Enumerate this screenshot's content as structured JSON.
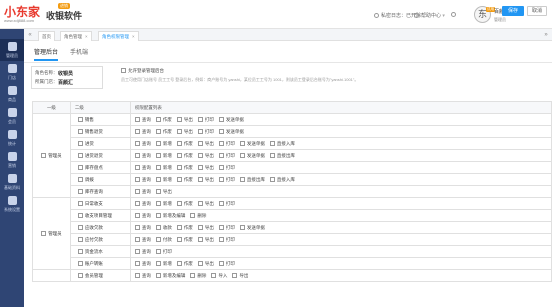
{
  "header": {
    "logo_text": "小东家",
    "logo_badge": "进销",
    "logo_sub": "收银软件",
    "logo_url": "www.xdj888.com",
    "items": [
      {
        "label": "私密日志：已开除",
        "icon": "user-icon"
      },
      {
        "label": "帮助中心",
        "icon": "help-icon"
      },
      {
        "label": "消息",
        "icon": "bell-icon"
      }
    ],
    "avatar_char": "东",
    "user_badge": "试用",
    "user_name": "百颜汇",
    "user_role": "管理员"
  },
  "sidebar": {
    "items": [
      {
        "label": "管理员",
        "icon": "dashboard-icon",
        "active": true
      },
      {
        "label": "门店",
        "icon": "store-icon"
      },
      {
        "label": "商品",
        "icon": "box-icon"
      },
      {
        "label": "会员",
        "icon": "members-icon"
      },
      {
        "label": "统计",
        "icon": "chart-icon"
      },
      {
        "label": "营销",
        "icon": "tag-icon"
      },
      {
        "label": "基础资料",
        "icon": "doc-icon"
      },
      {
        "label": "系统设置",
        "icon": "gear-icon"
      }
    ]
  },
  "tabs": [
    {
      "label": "首页",
      "active": false,
      "closable": false
    },
    {
      "label": "角色管理",
      "active": false,
      "closable": true
    },
    {
      "label": "角色权限管理",
      "active": true,
      "closable": true
    }
  ],
  "subtabs": [
    "管理后台",
    "手机端"
  ],
  "buttons": {
    "save": "保存",
    "cancel": "取消"
  },
  "role_info": {
    "name_label": "角色名称：",
    "name_value": "收银员",
    "dept_label": "所属门店：",
    "dept_value": "百颜汇",
    "dash_note": "允许登录管理后台",
    "dash_desc": "员工可使用门店账号 员工工号 登录后台，例如：商户账号为 yanshi，某位员工工号为 1001，则该员工登录后台账号为\"yanshi.1001\"。"
  },
  "table": {
    "headers": [
      "一级",
      "二级",
      "权限配置列表"
    ],
    "groups": [
      {
        "name": "管理员",
        "rows": [
          {
            "name": "销售",
            "perms": [
              "查询",
              "作废",
              "导出",
              "打印",
              "发送单据"
            ]
          },
          {
            "name": "销售退货",
            "perms": [
              "查询",
              "作废",
              "导出",
              "打印",
              "发送单据"
            ]
          },
          {
            "name": "进货",
            "perms": [
              "查询",
              "新增",
              "作废",
              "导出",
              "打印",
              "发送单据",
              "直接入库"
            ]
          },
          {
            "name": "进货退货",
            "perms": [
              "查询",
              "新增",
              "作废",
              "导出",
              "打印",
              "发送单据",
              "直接出库"
            ]
          },
          {
            "name": "库存盘点",
            "perms": [
              "查询",
              "新增",
              "作废",
              "导出",
              "打印"
            ]
          },
          {
            "name": "调拨",
            "perms": [
              "查询",
              "新增",
              "作废",
              "导出",
              "打印",
              "直接出库",
              "直接入库"
            ]
          },
          {
            "name": "库存查询",
            "perms": [
              "查询",
              "导出"
            ]
          }
        ]
      },
      {
        "name": "管理员",
        "rows": [
          {
            "name": "日常收支",
            "perms": [
              "查询",
              "新增",
              "作废",
              "导出",
              "打印"
            ]
          },
          {
            "name": "收支项目管理",
            "perms": [
              "查询",
              "新增及编辑",
              "删除"
            ]
          },
          {
            "name": "应收欠款",
            "perms": [
              "查询",
              "收款",
              "作废",
              "导出",
              "打印",
              "发送单据"
            ]
          },
          {
            "name": "应付欠款",
            "perms": [
              "查询",
              "付款",
              "作废",
              "导出",
              "打印"
            ]
          },
          {
            "name": "资金流水",
            "perms": [
              "查询",
              "打印"
            ]
          },
          {
            "name": "账户转账",
            "perms": [
              "查询",
              "新增",
              "作废",
              "导出",
              "打印"
            ]
          }
        ]
      },
      {
        "name": "",
        "rows": [
          {
            "name": "会员管理",
            "perms": [
              "查询",
              "新增及编辑",
              "删除",
              "导入",
              "导出"
            ]
          }
        ]
      }
    ]
  }
}
